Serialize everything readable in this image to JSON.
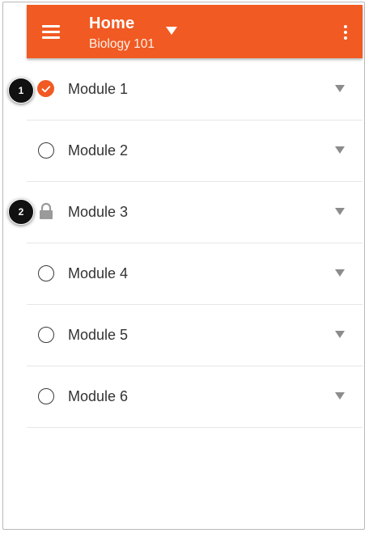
{
  "app_bar": {
    "title": "Home",
    "subtitle": "Biology 101",
    "menu_icon": "hamburger-menu-icon",
    "course_dropdown_icon": "caret-down-icon",
    "overflow_icon": "more-vertical-icon",
    "color": "#f15a22"
  },
  "modules": [
    {
      "label": "Module 1",
      "status": "completed"
    },
    {
      "label": "Module 2",
      "status": "incomplete"
    },
    {
      "label": "Module 3",
      "status": "locked"
    },
    {
      "label": "Module 4",
      "status": "incomplete"
    },
    {
      "label": "Module 5",
      "status": "incomplete"
    },
    {
      "label": "Module 6",
      "status": "incomplete"
    }
  ],
  "callouts": [
    {
      "number": "1"
    },
    {
      "number": "2"
    }
  ]
}
